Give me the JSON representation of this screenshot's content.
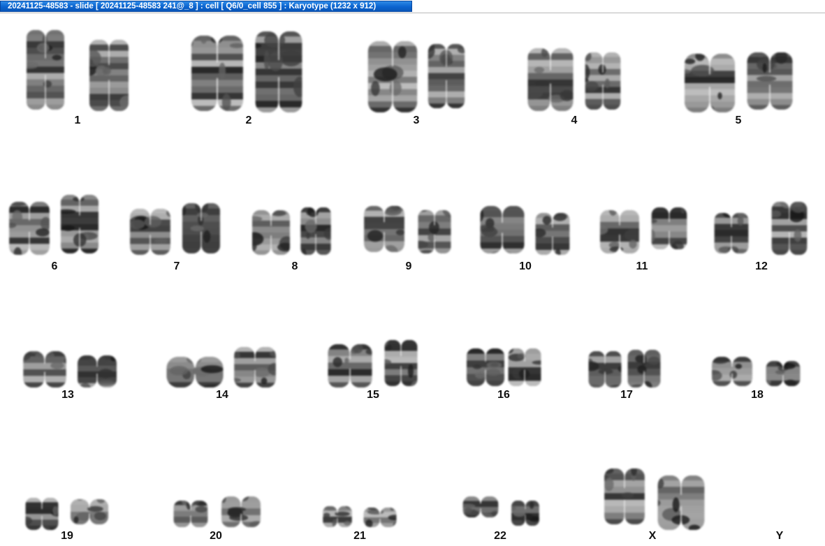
{
  "window": {
    "title": "20241125-48583 - slide [ 20241125-48583 241@_8 ] : cell [ Q6/0_cell 855 ] : Karyotype  (1232 x 912)"
  },
  "karyotype": {
    "chromosomes": [
      {
        "label": "1"
      },
      {
        "label": "2"
      },
      {
        "label": "3"
      },
      {
        "label": "4"
      },
      {
        "label": "5"
      },
      {
        "label": "6"
      },
      {
        "label": "7"
      },
      {
        "label": "8"
      },
      {
        "label": "9"
      },
      {
        "label": "10"
      },
      {
        "label": "11"
      },
      {
        "label": "12"
      },
      {
        "label": "13"
      },
      {
        "label": "14"
      },
      {
        "label": "15"
      },
      {
        "label": "16"
      },
      {
        "label": "17"
      },
      {
        "label": "18"
      },
      {
        "label": "19"
      },
      {
        "label": "20"
      },
      {
        "label": "21"
      },
      {
        "label": "22"
      },
      {
        "label": "X"
      },
      {
        "label": "Y"
      }
    ]
  }
}
